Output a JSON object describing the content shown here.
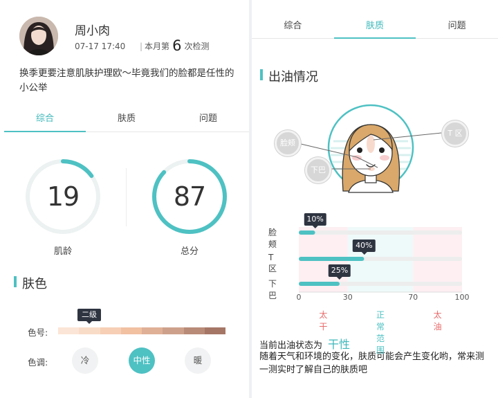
{
  "profile": {
    "name": "周小肉",
    "date": "07-17 17:40",
    "count_prefix": "本月第",
    "count": "6",
    "count_suffix": "次检测",
    "description": "换季更要注意肌肤护理欧～毕竟我们的脸都是任性的小公举"
  },
  "left_tabs": [
    "综合",
    "肤质",
    "问题"
  ],
  "left_active_tab": 0,
  "metrics": {
    "skin_age": {
      "value": "19",
      "label": "肌龄",
      "fill": 0.15
    },
    "score": {
      "value": "87",
      "label": "总分",
      "fill": 0.87
    }
  },
  "skin_color": {
    "title": "肤色",
    "color_label": "色号:",
    "grade": "二级",
    "grade_index": 1,
    "swatches": [
      "#fbe5d6",
      "#f9dcc8",
      "#f6cfb5",
      "#f1c1a2",
      "#dfb096",
      "#cda08b",
      "#b88a78",
      "#a57666"
    ],
    "tone_label": "色调:",
    "tones": [
      "冷",
      "中性",
      "暖"
    ],
    "tone_active": 1
  },
  "right_tabs": [
    "综合",
    "肤质",
    "问题"
  ],
  "right_active_tab": 1,
  "oil": {
    "title": "出油情况",
    "regions": {
      "cheek": "脸颊",
      "t_zone": "T 区",
      "chin": "下巴"
    },
    "zones": {
      "dry": "太干",
      "normal": "正常范围",
      "oily": "太油"
    },
    "status_label": "当前出油状态为",
    "status_value": "干性",
    "advice": "随着天气和环境的变化，肤质可能会产生变化哟，常来测一测实时了解自己的肤质吧"
  },
  "chart_data": {
    "type": "bar",
    "orientation": "horizontal",
    "categories": [
      "脸颊",
      "T 区",
      "下巴"
    ],
    "values": [
      10,
      40,
      25
    ],
    "value_labels": [
      "10%",
      "40%",
      "25%"
    ],
    "xlim": [
      0,
      100
    ],
    "xticks": [
      0,
      30,
      70,
      100
    ],
    "zones": [
      {
        "label": "太干",
        "from": 0,
        "to": 30,
        "color": "#fdeff2"
      },
      {
        "label": "正常范围",
        "from": 30,
        "to": 70,
        "color": "#eefaf9"
      },
      {
        "label": "太油",
        "from": 70,
        "to": 100,
        "color": "#fdeff2"
      }
    ],
    "bar_color": "#4ec1c3",
    "track_color": "#ededed",
    "grid": false
  },
  "colors": {
    "accent": "#4ec1c3",
    "zone_dry_text": "#e86a6a",
    "zone_normal_text": "#4ec1c3",
    "zone_oily_text": "#e86a6a",
    "tooltip": "#2f3441"
  }
}
